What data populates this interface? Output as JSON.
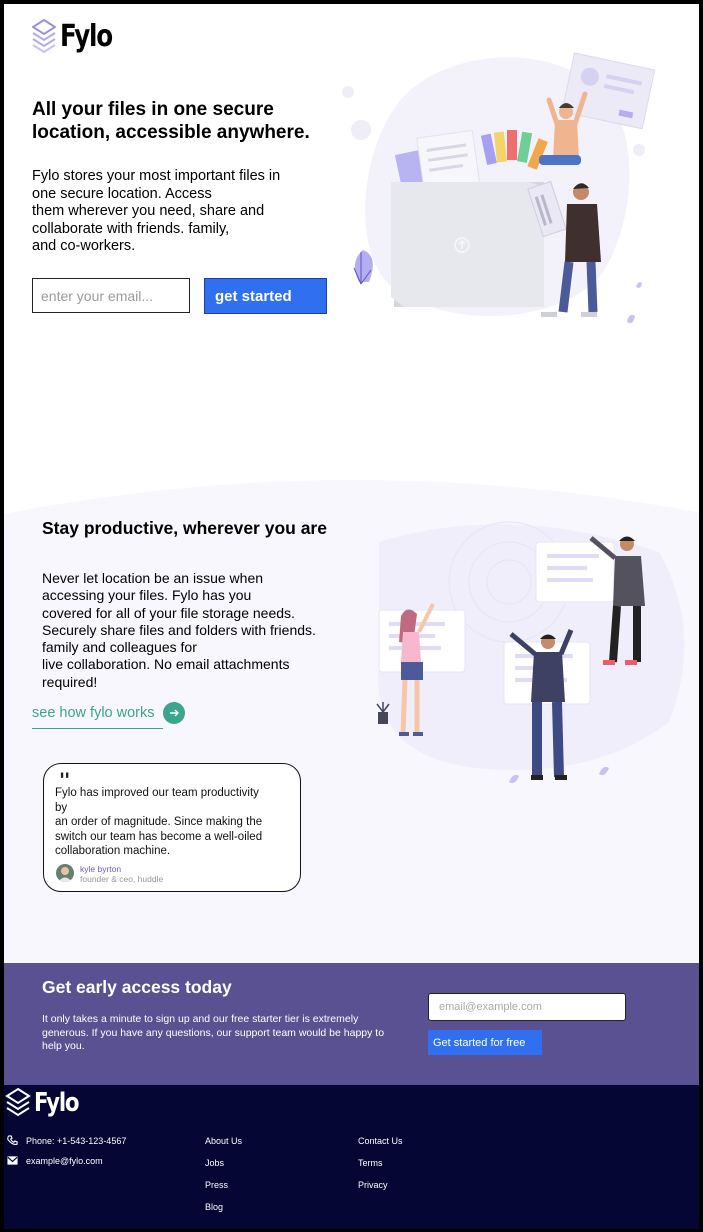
{
  "brand": {
    "name": "Fylo"
  },
  "hero": {
    "title": "All your files in one secure location, accessible anywhere.",
    "description": "Fylo stores your most important files in\none secure location. Access\nthem wherever you need, share and\ncollaborate with friends. family,\nand co-workers.",
    "email_placeholder": "enter your email...",
    "cta_label": "get started"
  },
  "productive": {
    "title": "Stay productive, wherever you are",
    "description": "Never let location be an issue when\naccessing your files. Fylo has you\ncovered for all of your file storage needs.\nSecurely share files and folders with friends.\nfamily and colleagues for\nlive collaboration. No email attachments\nrequired!",
    "link_label": "see how fylo works"
  },
  "testimonial": {
    "quote_mark": "\"",
    "text": "Fylo has improved our team productivity\nby\nan order of magnitude. Since making the\nswitch our team has become a well-oiled\ncollaboration machine.",
    "name": "kyle byrton",
    "role": "founder & ceo, huddle"
  },
  "early_access": {
    "title": "Get early access today",
    "description": "It only takes a minute to sign up and our free starter tier is extremely generous. If you have any questions, our support team would be happy to help you.",
    "email_placeholder": "email@example.com",
    "cta_label": "Get started for free"
  },
  "footer": {
    "phone": "Phone: +1-543-123-4567",
    "email": "example@fylo.com",
    "links_col1": [
      "About Us",
      "Jobs",
      "Press",
      "Blog"
    ],
    "links_col2": [
      "Contact Us",
      "Terms",
      "Privacy"
    ]
  },
  "colors": {
    "accent_blue": "#2f6ff0",
    "link_teal": "#3ba58e",
    "access_bg": "#5a5193",
    "footer_bg": "#050634",
    "section_bg": "#f8f7fd"
  }
}
